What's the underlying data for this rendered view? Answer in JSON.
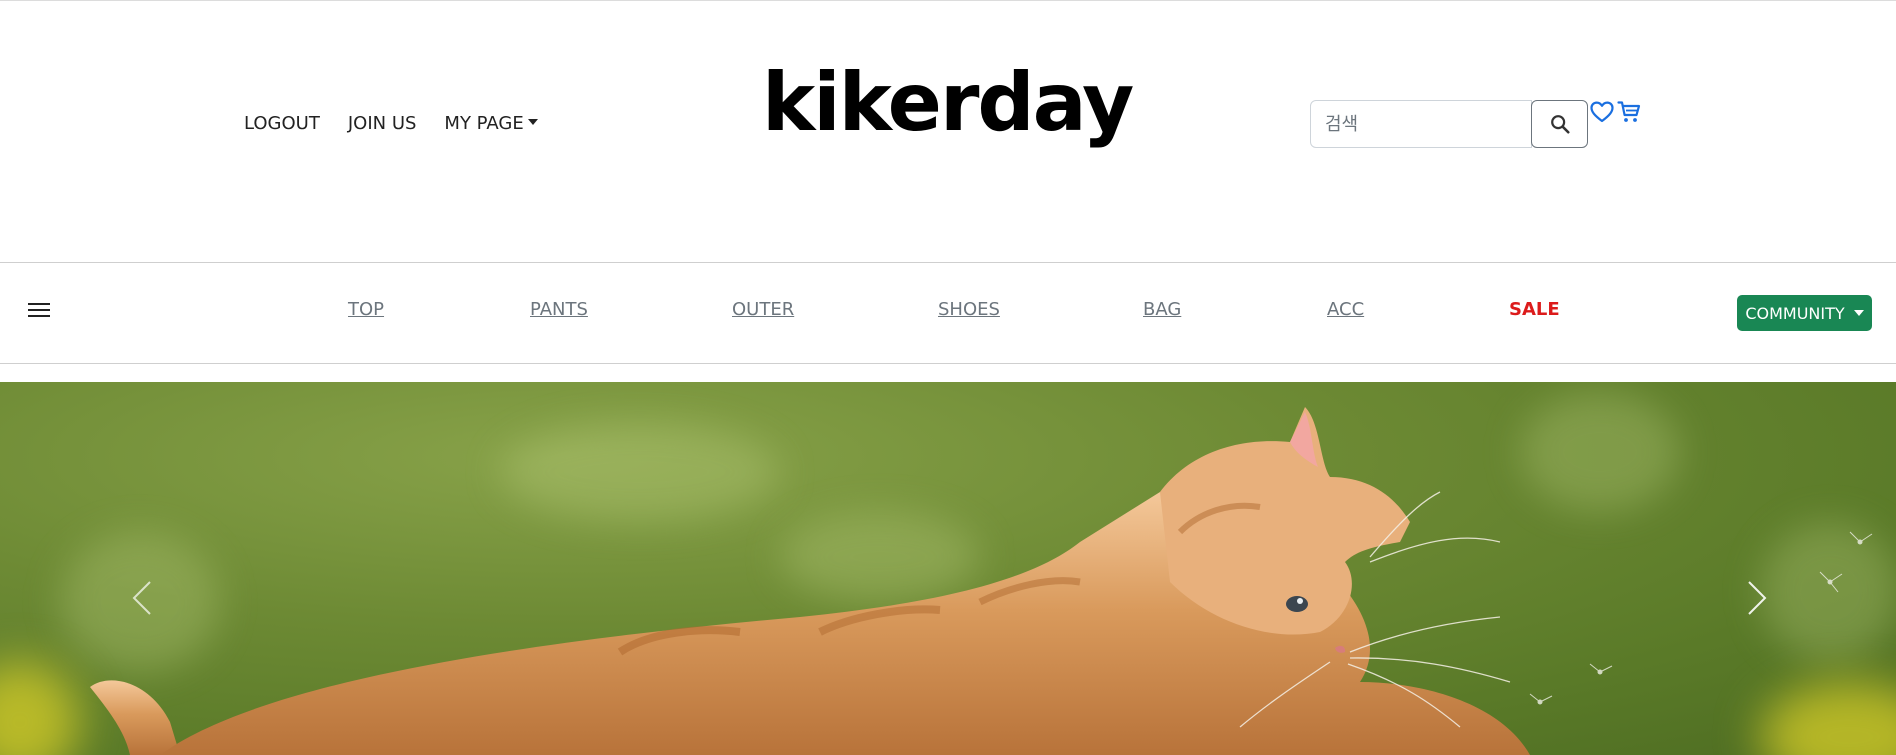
{
  "header": {
    "links": [
      {
        "label": "LOGOUT"
      },
      {
        "label": "JOIN US"
      },
      {
        "label": "MY PAGE"
      }
    ],
    "logo": "kikerday",
    "search": {
      "placeholder": "검색",
      "value": ""
    }
  },
  "icons": {
    "search": "search-icon",
    "wishlist": "heart-icon",
    "cart": "cart-icon",
    "menu": "hamburger-icon",
    "prev": "chevron-left-icon",
    "next": "chevron-right-icon"
  },
  "categories": [
    {
      "label": "TOP"
    },
    {
      "label": "PANTS"
    },
    {
      "label": "OUTER"
    },
    {
      "label": "SHOES"
    },
    {
      "label": "BAG"
    },
    {
      "label": "ACC"
    },
    {
      "label": "SALE"
    }
  ],
  "community": {
    "label": "COMMUNITY"
  },
  "colors": {
    "accent_green": "#198754",
    "sale_red": "#dc1b1b",
    "icon_blue": "#1a6fe0"
  }
}
